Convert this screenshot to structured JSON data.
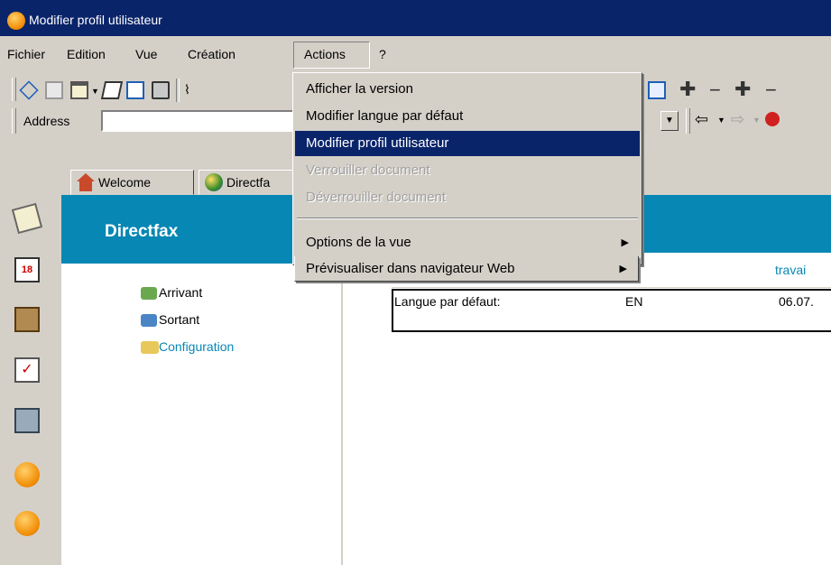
{
  "window": {
    "title": "Modifier profil utilisateur"
  },
  "menubar": {
    "items": [
      "Fichier",
      "Edition",
      "Vue",
      "Création",
      "Actions",
      "?"
    ]
  },
  "address": {
    "label": "Address",
    "value": ""
  },
  "tabs": [
    {
      "label": "Welcome",
      "icon": "home-icon"
    },
    {
      "label": "Directfa",
      "icon": "globe-icon"
    }
  ],
  "left_panel": {
    "title": "Directfax",
    "links": [
      "Arrivant",
      "Sortant",
      "Configuration"
    ]
  },
  "right_panel": {
    "column_header": "travai",
    "row": {
      "label": "Langue par défaut:",
      "value": "EN",
      "date": "06.07."
    }
  },
  "actions_menu": {
    "items": [
      {
        "label": "Afficher la version",
        "state": "normal"
      },
      {
        "label": "Modifier langue par défaut",
        "state": "normal"
      },
      {
        "label": "Modifier profil utilisateur",
        "state": "highlighted"
      },
      {
        "label": "Verrouiller document",
        "state": "disabled"
      },
      {
        "label": "Déverrouiller document",
        "state": "disabled"
      },
      {
        "label": "Options de la vue",
        "state": "submenu"
      },
      {
        "label": "Prévisualiser dans navigateur Web",
        "state": "submenu"
      }
    ]
  },
  "colors": {
    "titlebar": "#0a246a",
    "panel_header": "#0787b3",
    "menu_highlight": "#0a246a",
    "link": "#0787b3"
  }
}
